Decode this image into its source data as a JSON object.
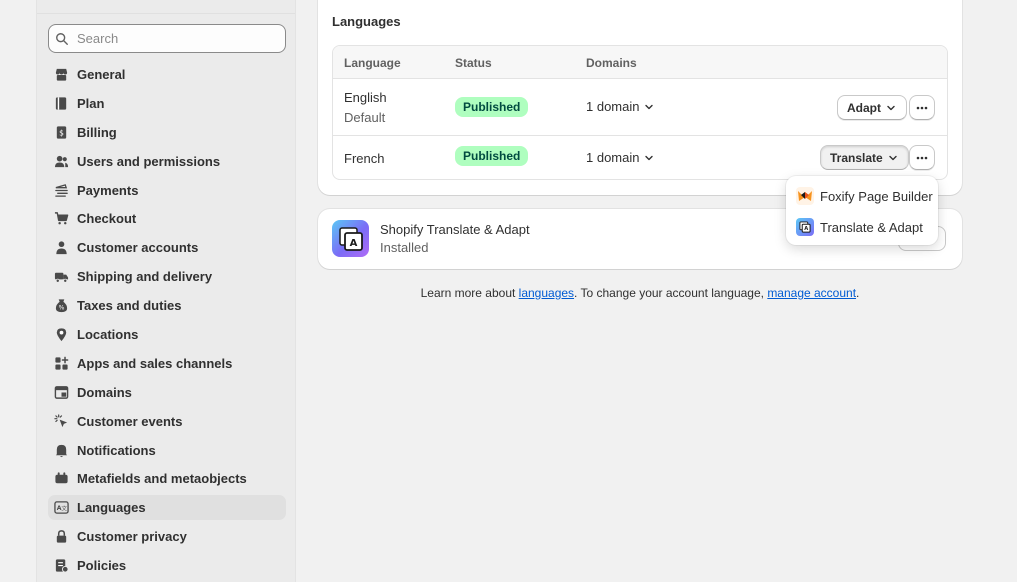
{
  "sidebar": {
    "search_placeholder": "Search",
    "items": [
      {
        "label": "General",
        "icon": "store-icon"
      },
      {
        "label": "Plan",
        "icon": "plan-icon"
      },
      {
        "label": "Billing",
        "icon": "billing-icon"
      },
      {
        "label": "Users and permissions",
        "icon": "users-icon"
      },
      {
        "label": "Payments",
        "icon": "payments-icon"
      },
      {
        "label": "Checkout",
        "icon": "cart-icon"
      },
      {
        "label": "Customer accounts",
        "icon": "person-icon"
      },
      {
        "label": "Shipping and delivery",
        "icon": "truck-icon"
      },
      {
        "label": "Taxes and duties",
        "icon": "tax-icon"
      },
      {
        "label": "Locations",
        "icon": "location-icon"
      },
      {
        "label": "Apps and sales channels",
        "icon": "apps-icon"
      },
      {
        "label": "Domains",
        "icon": "domains-icon"
      },
      {
        "label": "Customer events",
        "icon": "events-icon"
      },
      {
        "label": "Notifications",
        "icon": "bell-icon"
      },
      {
        "label": "Metafields and metaobjects",
        "icon": "metafields-icon"
      },
      {
        "label": "Languages",
        "icon": "languages-icon",
        "active": true
      },
      {
        "label": "Customer privacy",
        "icon": "lock-icon"
      },
      {
        "label": "Policies",
        "icon": "policies-icon"
      }
    ]
  },
  "languages_card": {
    "title": "Languages",
    "columns": {
      "language": "Language",
      "status": "Status",
      "domains": "Domains"
    },
    "rows": [
      {
        "language": "English",
        "sub": "Default",
        "status": "Published",
        "domains": "1 domain",
        "action": "Adapt"
      },
      {
        "language": "French",
        "sub": "",
        "status": "Published",
        "domains": "1 domain",
        "action": "Translate"
      }
    ]
  },
  "app_card": {
    "name": "Shopify Translate & Adapt",
    "status": "Installed"
  },
  "footer": {
    "prefix": "Learn more about ",
    "link1": "languages",
    "middle": ". To change your account language, ",
    "link2": "manage account",
    "suffix": "."
  },
  "popover": {
    "items": [
      {
        "label": "Foxify Page Builder",
        "icon": "foxify-icon"
      },
      {
        "label": "Translate & Adapt",
        "icon": "translate-adapt-icon"
      }
    ]
  },
  "colors": {
    "badge_bg": "#affebf",
    "badge_text": "#014b40",
    "link": "#005bd3"
  }
}
